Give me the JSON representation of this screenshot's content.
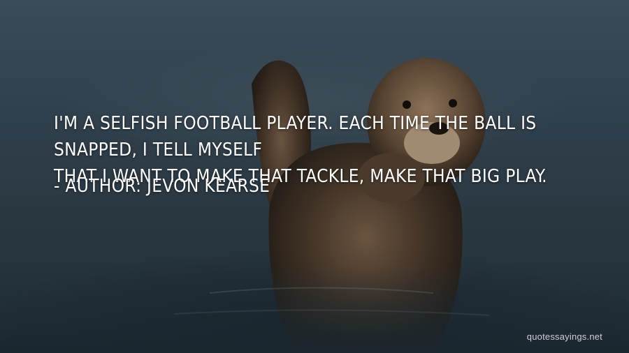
{
  "quote": {
    "line1": "I'm a selfish football player. Each time the ball is snapped, I tell myself",
    "line2": "that I want to make that tackle, make that big play.",
    "author_prefix": "- Author:",
    "author_name": "Jevon Kearse"
  },
  "watermark": {
    "text": "quotessayings.net"
  },
  "colors": {
    "text": "#ffffff",
    "water": "#2a3a44",
    "otter_fur": "#4a3a2a"
  }
}
